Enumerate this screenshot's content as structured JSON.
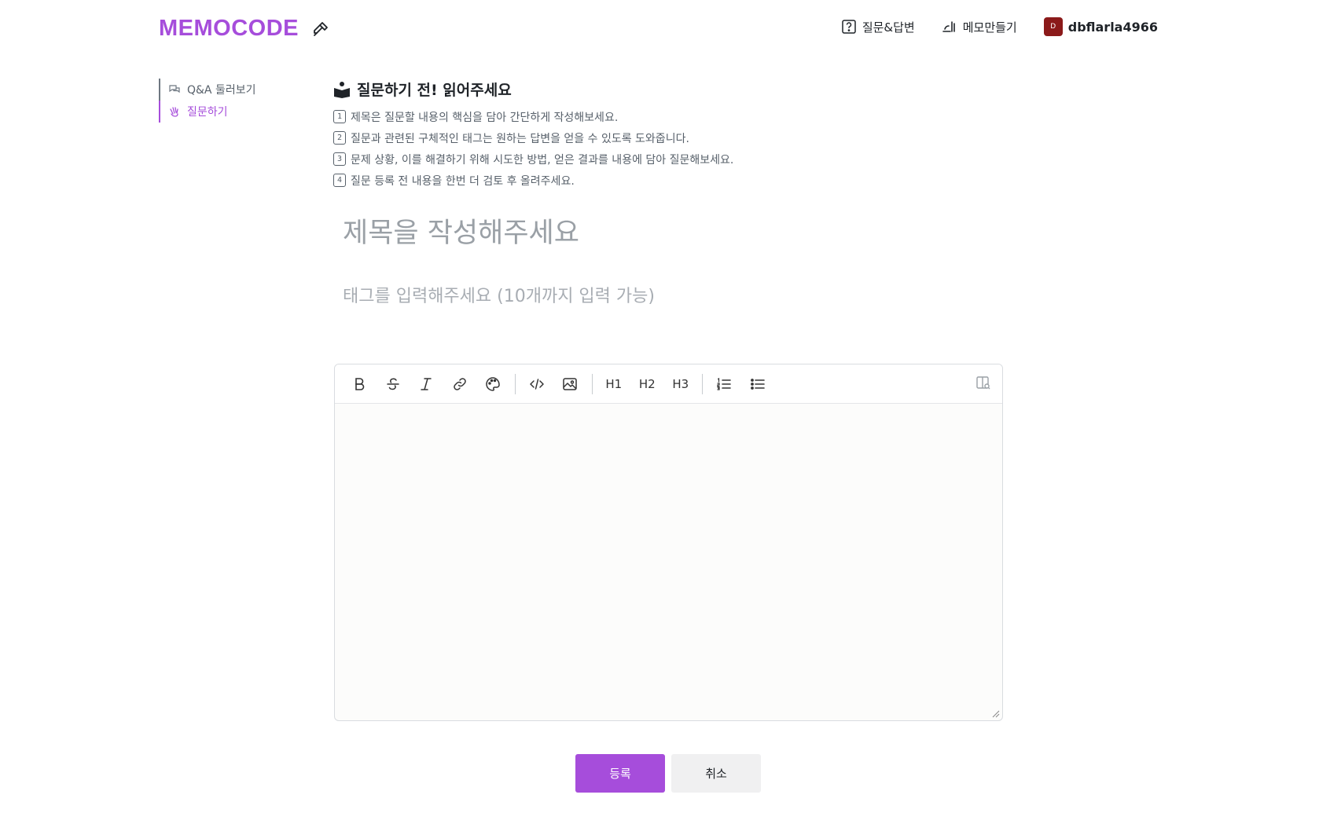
{
  "header": {
    "logo": "MEMOCODE",
    "nav": [
      {
        "label": "질문&답변",
        "icon": "question-box-icon"
      },
      {
        "label": "메모만들기",
        "icon": "memo-icon"
      }
    ],
    "user": {
      "avatar_letter": "D",
      "name": "dbflarla4966",
      "avatar_color": "#8b1a1a"
    }
  },
  "sidebar": {
    "items": [
      {
        "label": "Q&A 둘러보기",
        "icon": "chat-bubbles-icon",
        "active": false
      },
      {
        "label": "질문하기",
        "icon": "hand-wave-icon",
        "active": true
      }
    ]
  },
  "guide": {
    "title": "질문하기 전! 읽어주세요",
    "items": [
      {
        "num": "1",
        "text": "제목은 질문할 내용의 핵심을 담아 간단하게 작성해보세요."
      },
      {
        "num": "2",
        "text": "질문과 관련된 구체적인 태그는 원하는 답변을 얻을 수 있도록 도와줍니다."
      },
      {
        "num": "3",
        "text": "문제 상황, 이를 해결하기 위해 시도한 방법, 얻은 결과를 내용에 담아 질문해보세요."
      },
      {
        "num": "4",
        "text": "질문 등록 전 내용을 한번 더 검토 후 올려주세요."
      }
    ]
  },
  "form": {
    "title_placeholder": "제목을 작성해주세요",
    "tag_placeholder": "태그를 입력해주세요 (10개까지 입력 가능)"
  },
  "toolbar": {
    "h1": "H1",
    "h2": "H2",
    "h3": "H3"
  },
  "actions": {
    "submit": "등록",
    "cancel": "취소"
  },
  "colors": {
    "accent": "#a64ddb"
  }
}
